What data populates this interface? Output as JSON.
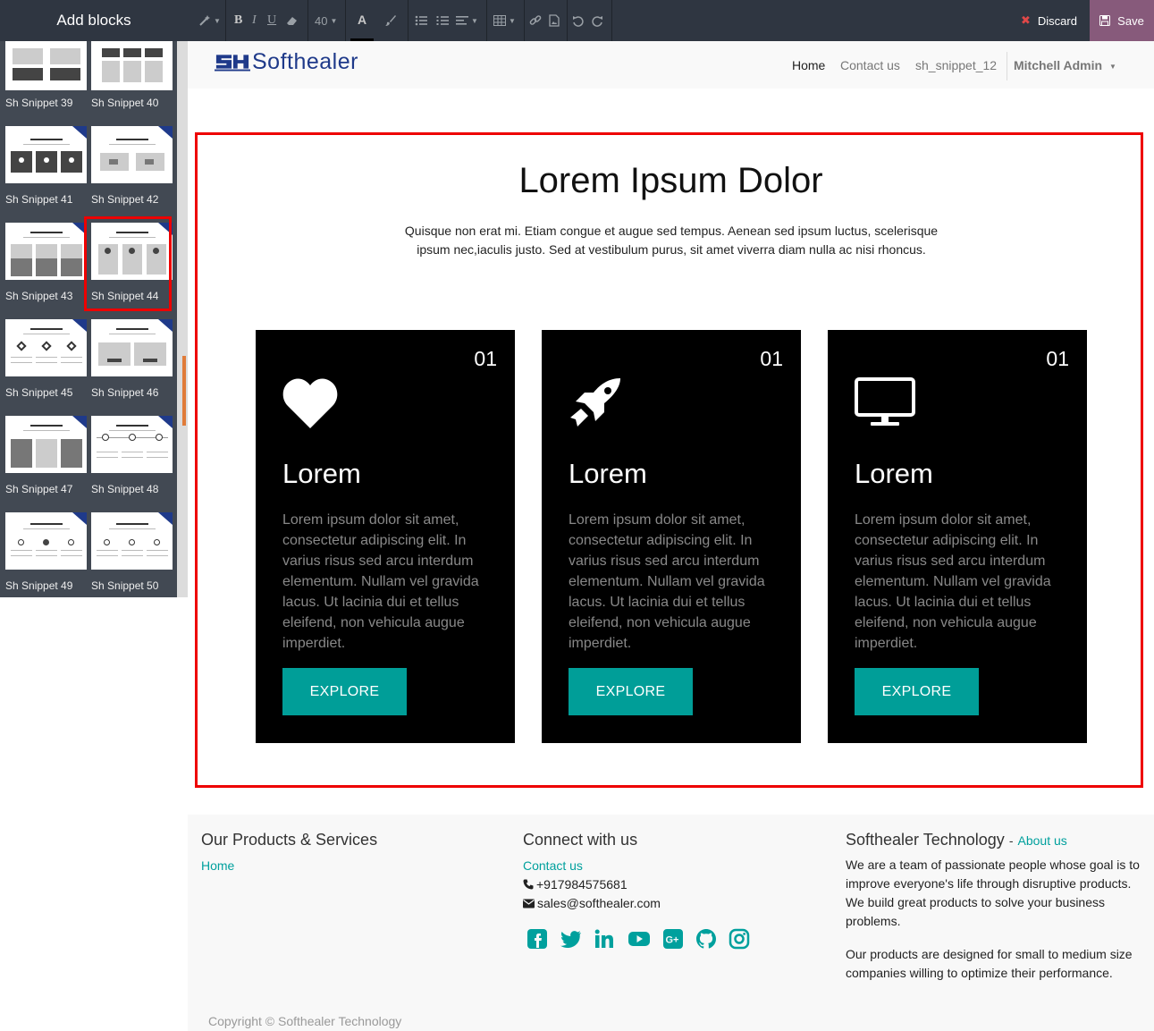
{
  "sidebar": {
    "title": "Add blocks",
    "snippets": [
      {
        "label": "Sh Snippet 39"
      },
      {
        "label": "Sh Snippet 40"
      },
      {
        "label": "Sh Snippet 41"
      },
      {
        "label": "Sh Snippet 42"
      },
      {
        "label": "Sh Snippet 43"
      },
      {
        "label": "Sh Snippet 44",
        "selected": true
      },
      {
        "label": "Sh Snippet 45"
      },
      {
        "label": "Sh Snippet 46"
      },
      {
        "label": "Sh Snippet 47"
      },
      {
        "label": "Sh Snippet 48"
      },
      {
        "label": "Sh Snippet 49"
      },
      {
        "label": "Sh Snippet 50"
      }
    ]
  },
  "toolbar": {
    "font_size": "40",
    "bold": "B",
    "italic": "I",
    "underline": "U",
    "font_color_letter": "A",
    "discard_label": "Discard",
    "save_label": "Save"
  },
  "header": {
    "logo_text": "Softhealer",
    "nav": [
      {
        "label": "Home",
        "active": true
      },
      {
        "label": "Contact us"
      },
      {
        "label": "sh_snippet_12"
      }
    ],
    "user": "Mitchell Admin"
  },
  "main": {
    "title": "Lorem Ipsum Dolor",
    "description": "Quisque non erat mi. Etiam congue et augue sed tempus. Aenean sed ipsum luctus, scelerisque ipsum nec,iaculis justo. Sed at vestibulum purus, sit amet viverra diam nulla ac nisi rhoncus.",
    "cards": [
      {
        "number": "01",
        "icon": "heart-icon",
        "title": "Lorem",
        "text": "Lorem ipsum dolor sit amet, consectetur adipiscing elit. In varius risus sed arcu interdum elementum. Nullam vel gravida lacus. Ut lacinia dui et tellus eleifend, non vehicula augue imperdiet.",
        "button": "EXPLORE"
      },
      {
        "number": "01",
        "icon": "rocket-icon",
        "title": "Lorem",
        "text": "Lorem ipsum dolor sit amet, consectetur adipiscing elit. In varius risus sed arcu interdum elementum. Nullam vel gravida lacus. Ut lacinia dui et tellus eleifend, non vehicula augue imperdiet.",
        "button": "EXPLORE"
      },
      {
        "number": "01",
        "icon": "desktop-icon",
        "title": "Lorem",
        "text": "Lorem ipsum dolor sit amet, consectetur adipiscing elit. In varius risus sed arcu interdum elementum. Nullam vel gravida lacus. Ut lacinia dui et tellus eleifend, non vehicula augue imperdiet.",
        "button": "EXPLORE"
      }
    ],
    "accent_color": "#009e98"
  },
  "footer": {
    "products_title": "Our Products & Services",
    "products_links": [
      "Home"
    ],
    "connect_title": "Connect with us",
    "connect_link": "Contact us",
    "phone": "+917984575681",
    "email": "sales@softhealer.com",
    "about_title": "Softhealer Technology",
    "about_sep": "-",
    "about_link": "About us",
    "about_p1": "We are a team of passionate people whose goal is to improve everyone's life through disruptive products. We build great products to solve your business problems.",
    "about_p2": "Our products are designed for small to medium size companies willing to optimize their performance.",
    "social_icons": [
      "facebook-icon",
      "twitter-icon",
      "linkedin-icon",
      "youtube-icon",
      "google-plus-icon",
      "github-icon",
      "instagram-icon"
    ],
    "copyright": "Copyright © Softhealer Technology"
  }
}
